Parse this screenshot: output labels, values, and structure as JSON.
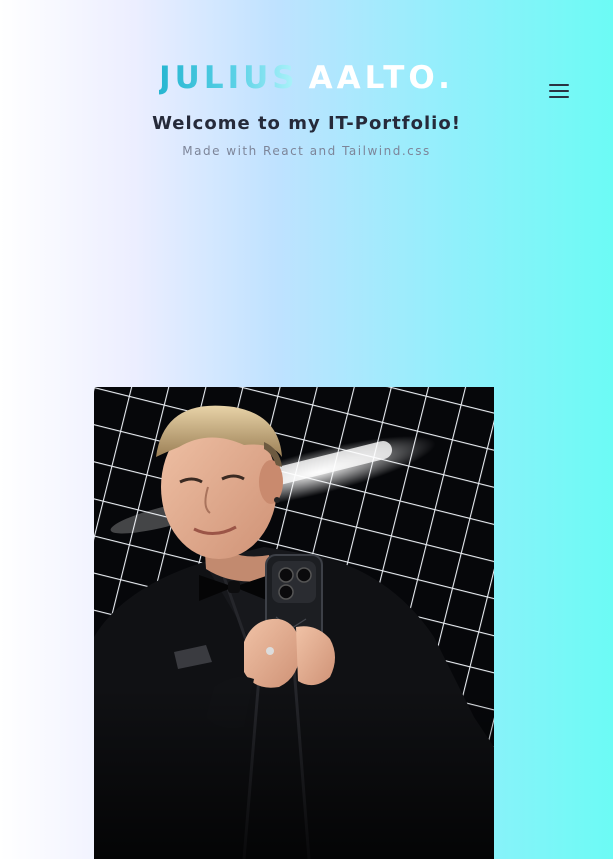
{
  "header": {
    "logo_first": "JULIUS",
    "logo_last": "AALTO.",
    "subtitle": "Welcome to my IT-Portfolio!",
    "tagline": "Made with React and Tailwind.css"
  },
  "nav": {
    "menu_icon": "hamburger-menu-icon"
  },
  "colors": {
    "gradient_start": "#ffffff",
    "gradient_end": "#6cfbf5",
    "logo_accent": "#27b6d1"
  }
}
